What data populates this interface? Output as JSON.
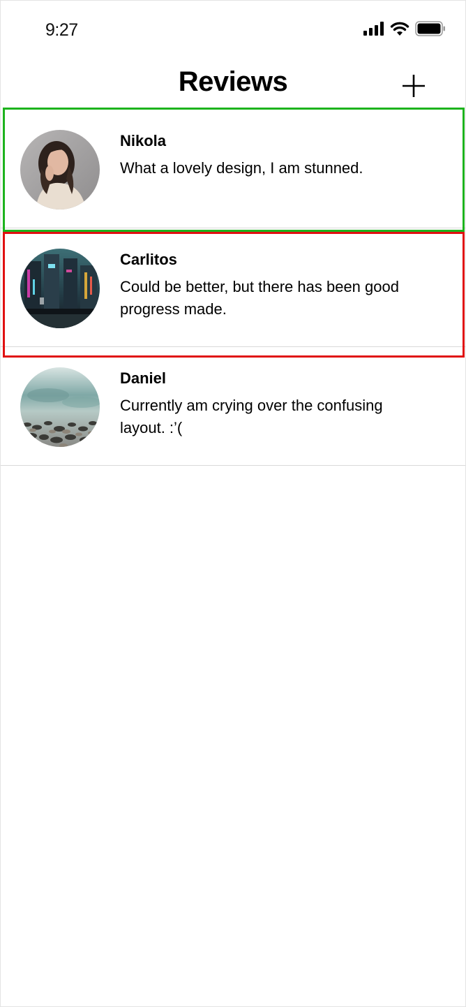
{
  "status_bar": {
    "time": "9:27",
    "icons": [
      "signal-icon",
      "wifi-icon",
      "battery-icon"
    ]
  },
  "header": {
    "title": "Reviews",
    "add_icon": "plus-icon"
  },
  "reviews": [
    {
      "name": "Nikola",
      "text": "What a lovely design, I am stunned.",
      "avatar": "portrait-photo"
    },
    {
      "name": "Carlitos",
      "text": "Could be better, but there has been good progress made.",
      "avatar": "city-night-photo"
    },
    {
      "name": "Daniel",
      "text": "Currently am crying over the confusing layout. :’(",
      "avatar": "pebbles-beach-photo"
    }
  ],
  "highlights": {
    "green": "#1db31d",
    "red": "#e01010"
  }
}
